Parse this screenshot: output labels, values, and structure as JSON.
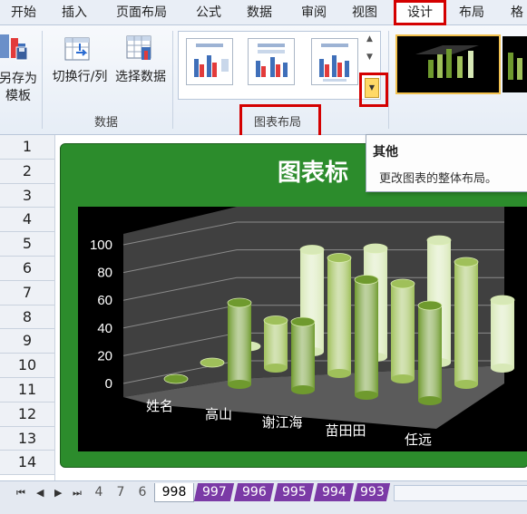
{
  "ribbon": {
    "tabs": [
      {
        "label": "开始"
      },
      {
        "label": "插入"
      },
      {
        "label": "页面布局"
      },
      {
        "label": "公式"
      },
      {
        "label": "数据"
      },
      {
        "label": "审阅"
      },
      {
        "label": "视图"
      },
      {
        "label": "设计"
      },
      {
        "label": "布局"
      },
      {
        "label": "格"
      }
    ],
    "save_template_label_line1": "另存为",
    "save_template_label_line2": "模板",
    "switch_row_col_label": "切换行/列",
    "select_data_label": "选择数据",
    "data_group_label": "数据",
    "chart_layout_group_label": "图表布局"
  },
  "tooltip": {
    "title": "其他",
    "description": "更改图表的整体布局。"
  },
  "sheet": {
    "row_numbers": [
      "1",
      "2",
      "3",
      "4",
      "5",
      "6",
      "7",
      "8",
      "9",
      "10",
      "11",
      "12",
      "13",
      "14"
    ],
    "chart_title": "图表标"
  },
  "chart_data": {
    "type": "bar",
    "variant": "3d-cylinder",
    "title": "",
    "categories": [
      "姓名",
      "高山",
      "谢江海",
      "苗田田",
      "任远"
    ],
    "yticks": [
      "100",
      "80",
      "60",
      "40",
      "20",
      "0"
    ],
    "ylim": [
      0,
      100
    ],
    "series": [
      {
        "values": [
          0,
          60,
          50,
          85,
          70
        ],
        "color": "#6f9a2e"
      },
      {
        "values": [
          0,
          35,
          85,
          70,
          90
        ],
        "color": "#9fc05a"
      },
      {
        "values": [
          0,
          75,
          80,
          90,
          50
        ],
        "color": "#d7e8b6"
      }
    ]
  },
  "sheet_tabs": {
    "left_tabs": [
      "4",
      "7",
      "6"
    ],
    "active": "998",
    "right_tabs": [
      "997",
      "996",
      "995",
      "994",
      "993"
    ]
  },
  "colors": {
    "chart_bg": "#2c8c2c",
    "plot_bg": "#000000",
    "highlight": "#d40000",
    "sheet_tab_purple": "#7b3aa6"
  }
}
